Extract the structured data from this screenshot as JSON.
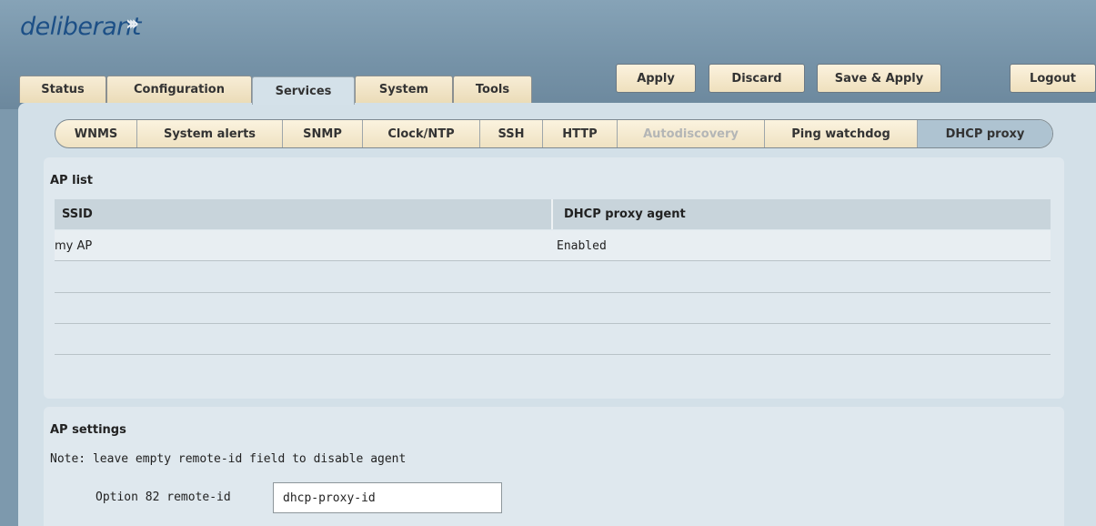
{
  "brand": {
    "name": "deliberant",
    "arrows": "›››"
  },
  "header_buttons": {
    "apply": "Apply",
    "discard": "Discard",
    "save_apply": "Save & Apply",
    "logout": "Logout"
  },
  "main_tabs": [
    {
      "label": "Status",
      "active": false
    },
    {
      "label": "Configuration",
      "active": false
    },
    {
      "label": "Services",
      "active": true
    },
    {
      "label": "System",
      "active": false
    },
    {
      "label": "Tools",
      "active": false
    }
  ],
  "sub_tabs": [
    {
      "label": "WNMS",
      "state": "normal"
    },
    {
      "label": "System alerts",
      "state": "normal"
    },
    {
      "label": "SNMP",
      "state": "normal"
    },
    {
      "label": "Clock/NTP",
      "state": "normal"
    },
    {
      "label": "SSH",
      "state": "normal"
    },
    {
      "label": "HTTP",
      "state": "normal"
    },
    {
      "label": "Autodiscovery",
      "state": "disabled"
    },
    {
      "label": "Ping watchdog",
      "state": "normal"
    },
    {
      "label": "DHCP proxy",
      "state": "active"
    }
  ],
  "ap_list": {
    "title": "AP list",
    "columns": [
      "SSID",
      "DHCP proxy agent"
    ],
    "rows": [
      {
        "ssid": "my AP",
        "agent": "Enabled"
      }
    ]
  },
  "ap_settings": {
    "title": "AP settings",
    "note": "Note: leave empty remote-id field to disable agent",
    "remote_id_label": "Option 82 remote-id",
    "remote_id_value": "dhcp-proxy-id"
  },
  "colors": {
    "header_bg": "#7d99ad",
    "logo": "#1c4f86",
    "button_bg": "#f3e6c7",
    "content_bg": "#d3e0e8",
    "active_subtab": "#aec3d1"
  }
}
